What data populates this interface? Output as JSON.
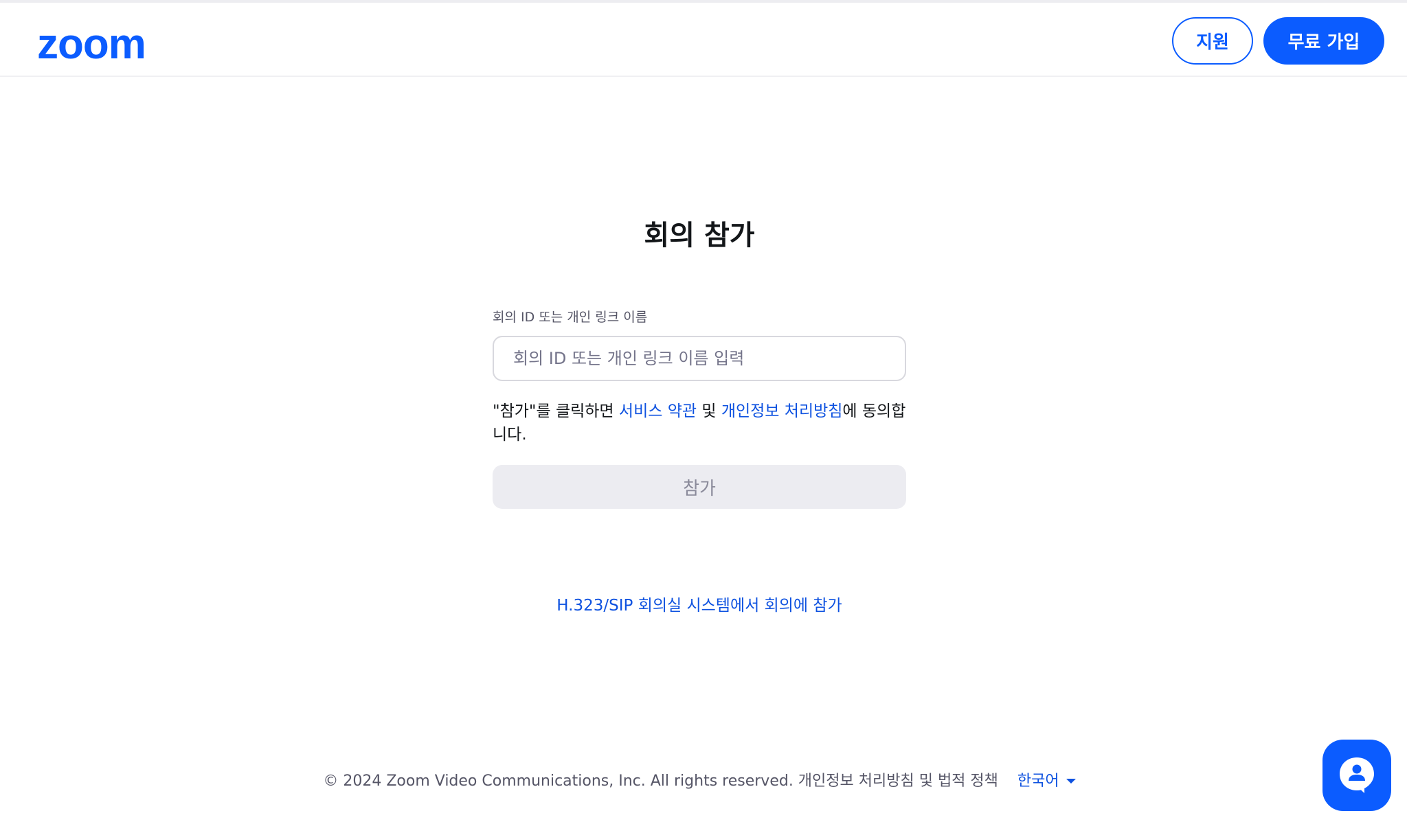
{
  "brand": {
    "logo_text": "zoom",
    "accent": "#0b5cff"
  },
  "header": {
    "support_label": "지원",
    "signup_label": "무료 가입"
  },
  "main": {
    "title": "회의 참가",
    "field_label": "회의 ID 또는 개인 링크 이름",
    "field_placeholder": "회의 ID 또는 개인 링크 이름 입력",
    "field_value": "",
    "agree_prefix": "\"참가\"를 클릭하면 ",
    "terms_link": "서비스 약관",
    "agree_and": " 및 ",
    "privacy_link": "개인정보 처리방침",
    "agree_suffix": "에 동의합니다.",
    "join_label": "참가",
    "sip_link": "H.323/SIP 회의실 시스템에서 회의에 참가"
  },
  "footer": {
    "copyright": "© 2024 Zoom Video Communications, Inc. All rights reserved. 개인정보 처리방침 및 법적 정책",
    "language": "한국어"
  },
  "icons": {
    "chat": "chat-assistant-icon",
    "language_caret": "caret-down-icon"
  }
}
